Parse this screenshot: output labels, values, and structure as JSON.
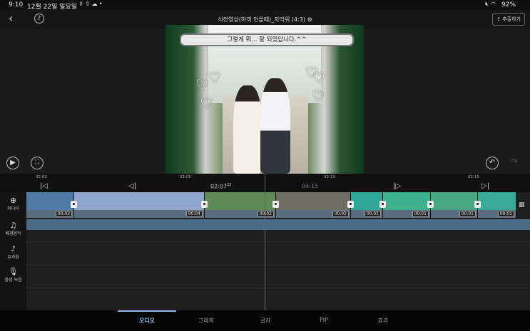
{
  "status_bar": {
    "time": "9:10",
    "date": "12월 22일 일요일",
    "battery": "92%"
  },
  "toolbar": {
    "title": "식전영상(하객 안올때)_자막위 (4:3)",
    "export_label": "추출하기"
  },
  "preview": {
    "subtitle": "그렇게 뭐... 잘 되었답니다.^^"
  },
  "ruler": {
    "ticks": [
      "02:00",
      "02:05",
      "02:10",
      "02:15"
    ]
  },
  "controls": {
    "current_time": "02:07",
    "current_frame": "23",
    "total_time": "04:15"
  },
  "sidebar": {
    "items": [
      {
        "label": "미디어",
        "icon": "plus-circle-icon"
      },
      {
        "label": "배경음악",
        "icon": "music-note-icon"
      },
      {
        "label": "효과음",
        "icon": "sound-effect-icon"
      },
      {
        "label": "음성 녹음",
        "icon": "microphone-icon"
      }
    ]
  },
  "clips": [
    {
      "duration": "00:03",
      "color": "#4f7aa8"
    },
    {
      "duration": "00:04",
      "color": "#8ea6cc"
    },
    {
      "duration": "00:02",
      "color": "#5d8a55"
    },
    {
      "duration": "00:02",
      "color": "#6d6d63"
    },
    {
      "duration": "00:01",
      "color": "#2fa89a"
    },
    {
      "duration": "00:01",
      "color": "#3db08e"
    },
    {
      "duration": "00:01",
      "color": "#48a883"
    },
    {
      "duration": "00:01",
      "color": "#3aa99a"
    }
  ],
  "bottom_tabs": [
    {
      "label": "오디오",
      "active": true
    },
    {
      "label": "그래픽"
    },
    {
      "label": "글자"
    },
    {
      "label": "PIP"
    },
    {
      "label": "효과"
    }
  ]
}
